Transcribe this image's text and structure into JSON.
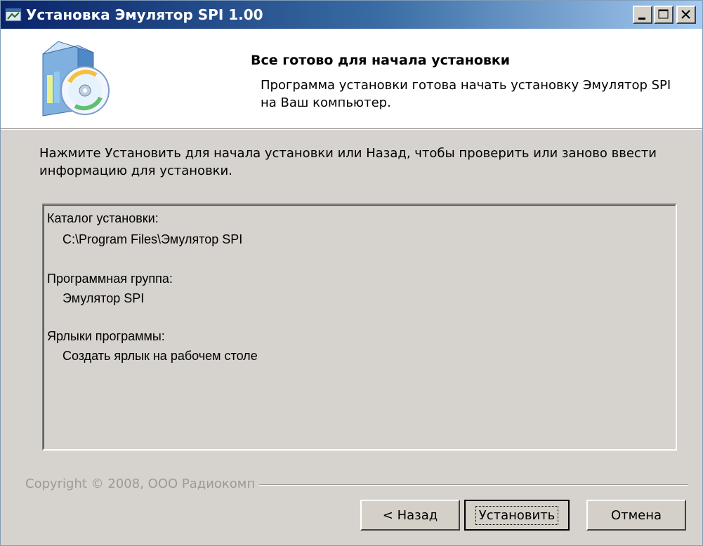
{
  "window": {
    "title": "Установка Эмулятор SPI 1.00",
    "controls": [
      "minimize-icon",
      "maximize-icon",
      "close-icon"
    ]
  },
  "header": {
    "title": "Все готово для начала установки",
    "subtitle": "Программа установки готова начать установку Эмулятор SPI на Ваш компьютер.",
    "icon": "setup-package-icon"
  },
  "intro": "Нажмите Установить для начала установки или Назад, чтобы проверить или заново ввести информацию для установки.",
  "memo": {
    "dir_label": "Каталог установки:",
    "dir_value": "C:\\Program Files\\Эмулятор SPI",
    "group_label": "Программная группа:",
    "group_value": "Эмулятор SPI",
    "shortcuts_label": "Ярлыки программы:",
    "shortcuts_value": "Создать ярлык на рабочем столе"
  },
  "footer": {
    "copyright": "Copyright © 2008, ООО Радиокомп"
  },
  "buttons": {
    "back": "< Назад",
    "install": "Установить",
    "cancel": "Отмена"
  },
  "colors": {
    "titlebar_start": "#0a246a",
    "titlebar_end": "#a6caf0",
    "dialog_bg": "#d6d3ce",
    "header_bg": "#ffffff"
  }
}
